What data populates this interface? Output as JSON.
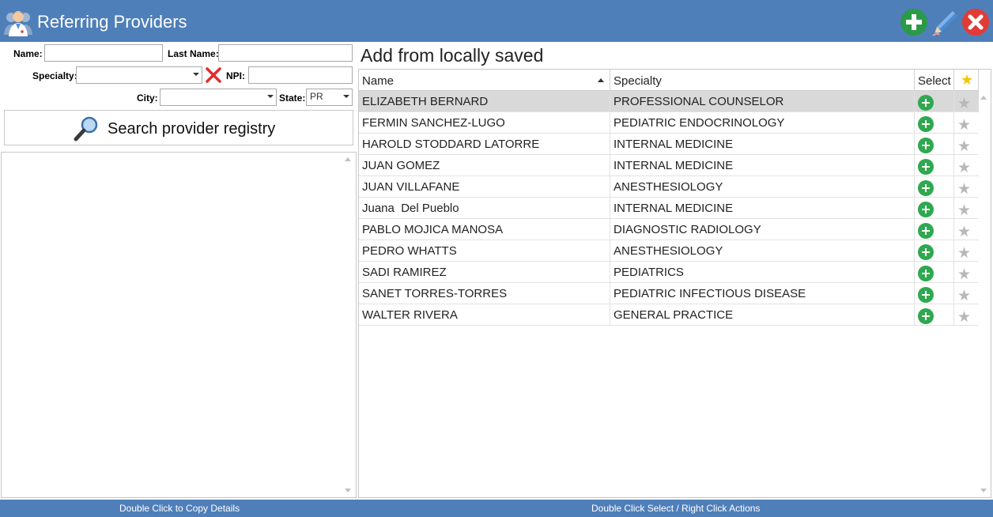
{
  "window": {
    "title": "Referring Providers"
  },
  "toolbar": {
    "add_icon": "plus-circle-icon",
    "edit_icon": "pencil-icon",
    "close_icon": "close-circle-icon"
  },
  "search_form": {
    "name_label": "Name:",
    "name_value": "",
    "last_name_label": "Last Name:",
    "last_name_value": "",
    "specialty_label": "Specialty:",
    "specialty_value": "",
    "npi_label": "NPI:",
    "npi_value": "",
    "city_label": "City:",
    "city_value": "",
    "state_label": "State:",
    "state_value": "PR",
    "search_button_label": "Search provider registry"
  },
  "local": {
    "title": "Add from locally saved",
    "columns": {
      "name": "Name",
      "specialty": "Specialty",
      "select": "Select",
      "favorite": "★"
    },
    "sort": {
      "column": "Name",
      "direction": "ascending"
    },
    "selected_row": 0,
    "rows": [
      {
        "name": "ELIZABETH BERNARD",
        "specialty": "PROFESSIONAL COUNSELOR"
      },
      {
        "name": "FERMIN SANCHEZ-LUGO",
        "specialty": "PEDIATRIC ENDOCRINOLOGY"
      },
      {
        "name": "HAROLD STODDARD LATORRE",
        "specialty": "INTERNAL MEDICINE"
      },
      {
        "name": "JUAN GOMEZ",
        "specialty": "INTERNAL MEDICINE"
      },
      {
        "name": "JUAN VILLAFANE",
        "specialty": "ANESTHESIOLOGY"
      },
      {
        "name": "Juana  Del Pueblo",
        "specialty": "INTERNAL MEDICINE"
      },
      {
        "name": "PABLO MOJICA MANOSA",
        "specialty": "DIAGNOSTIC RADIOLOGY"
      },
      {
        "name": "PEDRO WHATTS",
        "specialty": "ANESTHESIOLOGY"
      },
      {
        "name": "SADI RAMIREZ",
        "specialty": "PEDIATRICS"
      },
      {
        "name": "SANET TORRES-TORRES",
        "specialty": "PEDIATRIC INFECTIOUS DISEASE"
      },
      {
        "name": "WALTER RIVERA",
        "specialty": "GENERAL PRACTICE"
      }
    ]
  },
  "footer": {
    "left_hint": "Double Click to Copy Details",
    "right_hint": "Double Click Select / Right Click Actions"
  },
  "colors": {
    "titlebar": "#4f7fb9",
    "add_green": "#2fa84f",
    "close_red": "#e33a36",
    "star_gold": "#f5c400",
    "star_gray": "#b8b8b8",
    "selected_row": "#d9d9d9"
  }
}
